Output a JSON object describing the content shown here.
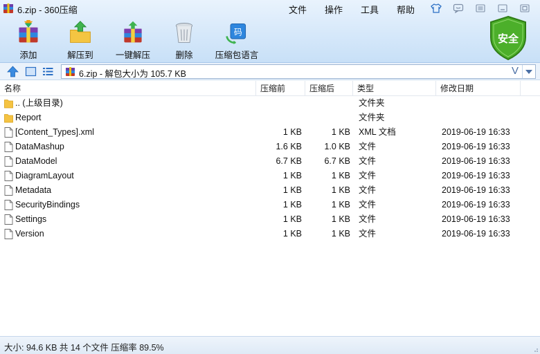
{
  "window": {
    "title": "6.zip - 360压缩"
  },
  "menu": [
    {
      "label": "文件"
    },
    {
      "label": "操作"
    },
    {
      "label": "工具"
    },
    {
      "label": "帮助"
    }
  ],
  "toolbar": [
    {
      "label": "添加",
      "icon": "add-archive-icon"
    },
    {
      "label": "解压到",
      "icon": "extract-to-icon"
    },
    {
      "label": "一键解压",
      "icon": "one-click-extract-icon"
    },
    {
      "label": "删除",
      "icon": "trash-icon"
    },
    {
      "label": "压缩包语言",
      "icon": "archive-language-icon"
    }
  ],
  "safe_badge": {
    "label": "安全"
  },
  "address": {
    "path": "6.zip - 解包大小为 105.7 KB",
    "v_glyph": "V"
  },
  "columns": {
    "name": "名称",
    "before": "压缩前",
    "after": "压缩后",
    "type": "类型",
    "modified": "修改日期"
  },
  "files": [
    {
      "name": ".. (上级目录)",
      "before": "",
      "after": "",
      "type": "文件夹",
      "modified": "",
      "icon": "folder-icon"
    },
    {
      "name": "Report",
      "before": "",
      "after": "",
      "type": "文件夹",
      "modified": "",
      "icon": "folder-icon"
    },
    {
      "name": "[Content_Types].xml",
      "before": "1 KB",
      "after": "1 KB",
      "type": "XML 文档",
      "modified": "2019-06-19 16:33",
      "icon": "file-icon"
    },
    {
      "name": "DataMashup",
      "before": "1.6 KB",
      "after": "1.0 KB",
      "type": "文件",
      "modified": "2019-06-19 16:33",
      "icon": "file-icon"
    },
    {
      "name": "DataModel",
      "before": "6.7 KB",
      "after": "6.7 KB",
      "type": "文件",
      "modified": "2019-06-19 16:33",
      "icon": "file-icon"
    },
    {
      "name": "DiagramLayout",
      "before": "1 KB",
      "after": "1 KB",
      "type": "文件",
      "modified": "2019-06-19 16:33",
      "icon": "file-icon"
    },
    {
      "name": "Metadata",
      "before": "1 KB",
      "after": "1 KB",
      "type": "文件",
      "modified": "2019-06-19 16:33",
      "icon": "file-icon"
    },
    {
      "name": "SecurityBindings",
      "before": "1 KB",
      "after": "1 KB",
      "type": "文件",
      "modified": "2019-06-19 16:33",
      "icon": "file-icon"
    },
    {
      "name": "Settings",
      "before": "1 KB",
      "after": "1 KB",
      "type": "文件",
      "modified": "2019-06-19 16:33",
      "icon": "file-icon"
    },
    {
      "name": "Version",
      "before": "1 KB",
      "after": "1 KB",
      "type": "文件",
      "modified": "2019-06-19 16:33",
      "icon": "file-icon"
    }
  ],
  "status": {
    "text": "大小: 94.6 KB 共 14 个文件 压缩率 89.5%"
  },
  "colors": {
    "accent": "#2b6fc4",
    "folder": "#f5c342",
    "safe_green": "#4caf2a"
  }
}
